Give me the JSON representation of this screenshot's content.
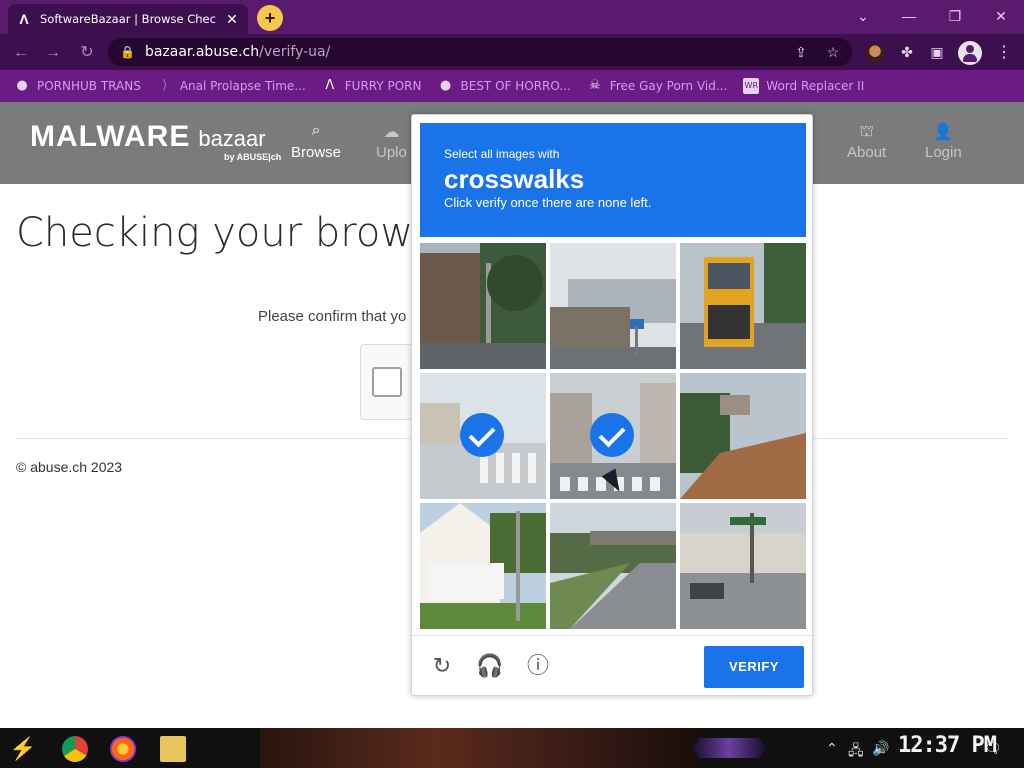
{
  "browser": {
    "tab_title": "SoftwareBazaar | Browse Chec",
    "tab_icon": "abuse-ch-icon",
    "url_host": "bazaar.abuse.ch",
    "url_path": "/verify-ua/",
    "theme_color": "#5a1a6e"
  },
  "bookmarks": [
    {
      "label": "PORNHUB TRANS",
      "icon": "globe-icon"
    },
    {
      "label": "Anal Prolapse Time...",
      "icon": "bracket-icon"
    },
    {
      "label": "FURRY PORN",
      "icon": "abuse-ch-icon"
    },
    {
      "label": "BEST OF HORRO...",
      "icon": "globe-icon"
    },
    {
      "label": "Free Gay Porn Vid...",
      "icon": "skull-icon"
    },
    {
      "label": "Word Replacer II",
      "icon": "wr-icon"
    }
  ],
  "site": {
    "logo_main": "MALWARE",
    "logo_sub": "bazaar",
    "logo_by": "by ABUSE|ch",
    "nav": [
      {
        "label": "Browse",
        "icon": "search-icon"
      },
      {
        "label": "Uplo",
        "icon": "upload-icon"
      },
      {
        "label": "About",
        "icon": "building-icon"
      },
      {
        "label": "Login",
        "icon": "user-icon"
      }
    ],
    "page_title": "Checking your browser",
    "confirm_text": "Please confirm that yo",
    "footer": "© abuse.ch 2023"
  },
  "captcha": {
    "small_text": "Select all images with",
    "target": "crosswalks",
    "instruction": "Click verify once there are none left.",
    "verify_label": "VERIFY",
    "accent": "#1a73e8",
    "tiles_selected": [
      3,
      4
    ]
  },
  "taskbar": {
    "clock": "12:37 PM"
  }
}
